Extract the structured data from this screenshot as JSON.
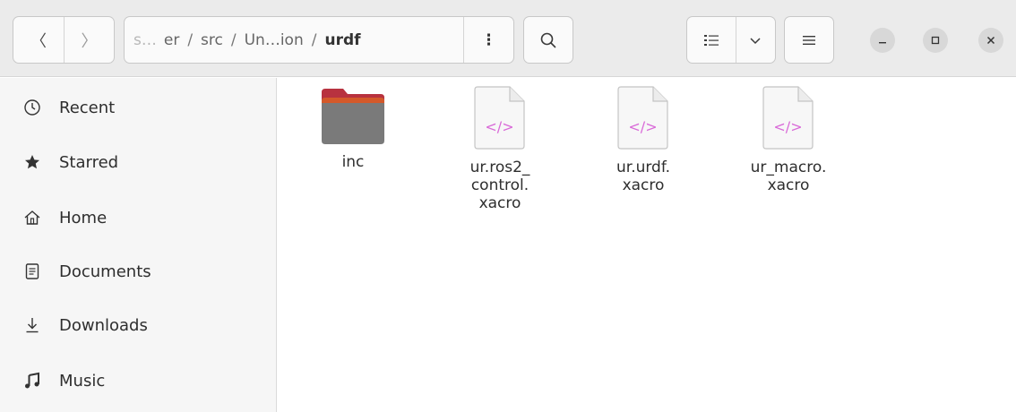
{
  "header": {
    "back_label": "〈",
    "forward_label": "〉",
    "path": {
      "prefix": "s…",
      "crumbs": [
        "er",
        "src",
        "Un…ion"
      ],
      "current": "urdf",
      "separator": "/",
      "menu_label": "⋮"
    }
  },
  "sidebar": {
    "items": [
      {
        "label": "Recent",
        "icon": "clock-icon"
      },
      {
        "label": "Starred",
        "icon": "star-icon"
      },
      {
        "label": "Home",
        "icon": "home-icon"
      },
      {
        "label": "Documents",
        "icon": "document-icon"
      },
      {
        "label": "Downloads",
        "icon": "download-icon"
      },
      {
        "label": "Music",
        "icon": "music-note-icon"
      }
    ]
  },
  "files": [
    {
      "name_lines": [
        "inc"
      ],
      "type": "folder"
    },
    {
      "name_lines": [
        "ur.ros2_",
        "control.",
        "xacro"
      ],
      "type": "code"
    },
    {
      "name_lines": [
        "ur.urdf.",
        "xacro"
      ],
      "type": "code"
    },
    {
      "name_lines": [
        "ur_macro.",
        "xacro"
      ],
      "type": "code"
    }
  ],
  "code_glyph": "</>",
  "colors": {
    "code_glyph": "#d96ad8",
    "folder_tab": "#b8323f",
    "folder_body": "#7a7a7a",
    "header_bg": "#ebebeb",
    "sidebar_bg": "#f6f6f6"
  }
}
